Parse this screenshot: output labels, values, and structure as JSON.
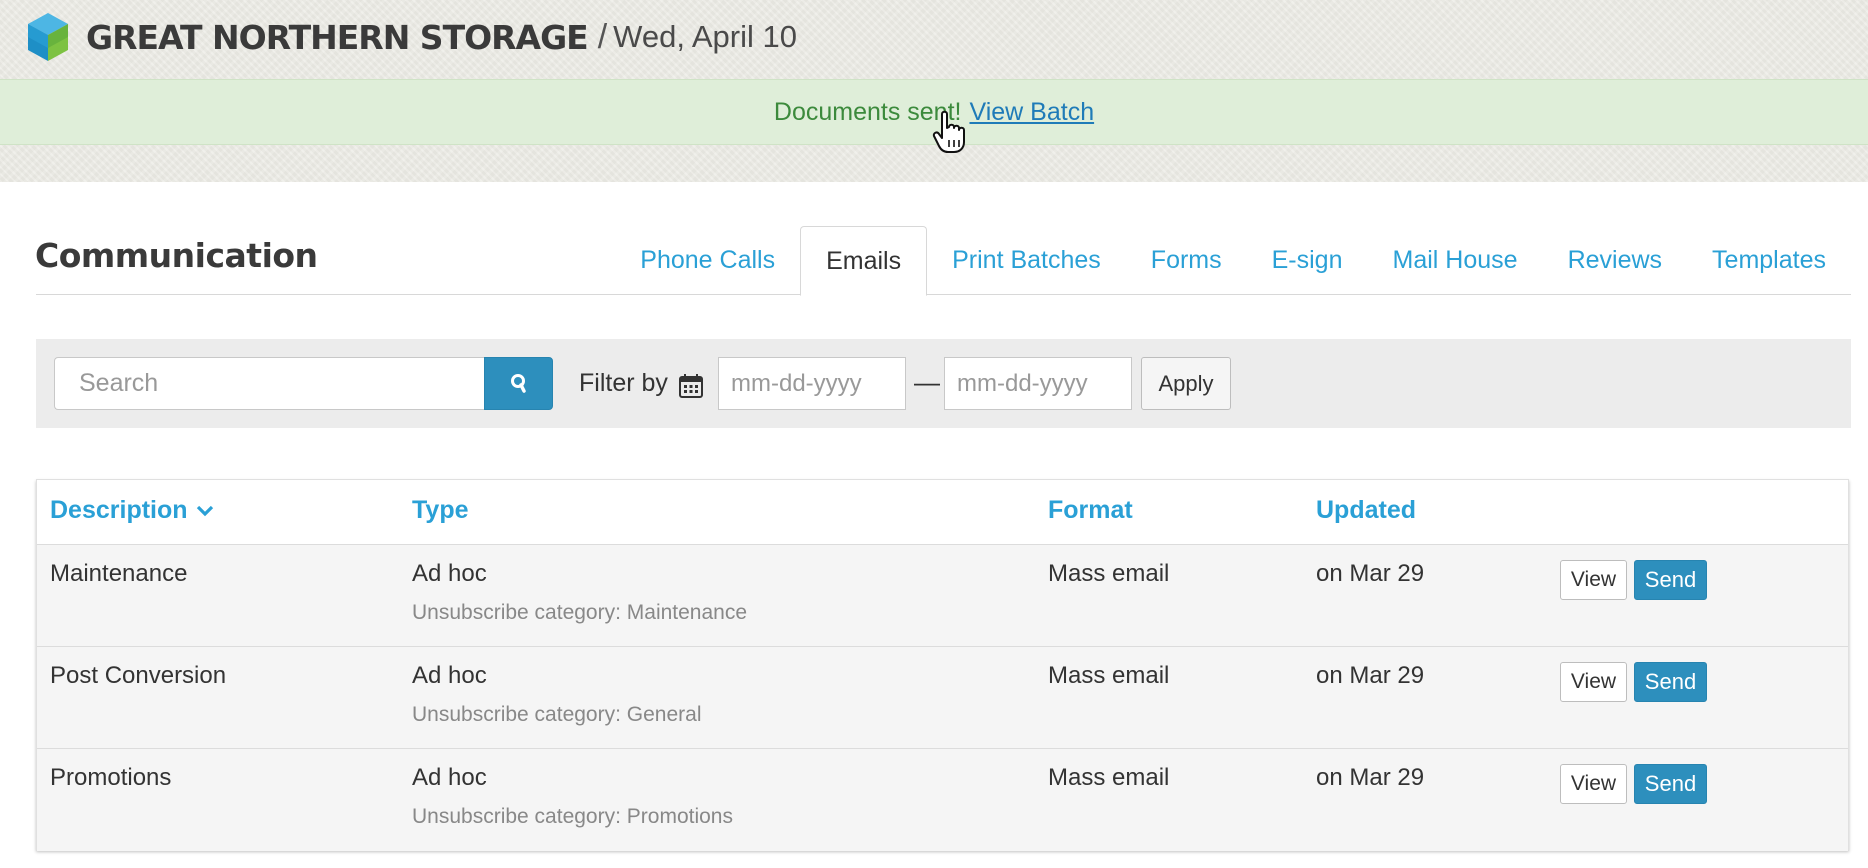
{
  "header": {
    "brand": "GREAT NORTHERN STORAGE",
    "separator": "/",
    "date": "Wed, April 10",
    "logo_icon": "cube-logo-icon"
  },
  "flash": {
    "message": "Documents sent!",
    "link_label": "View Batch",
    "color": "#3c8a3c",
    "background": "#dfeed9"
  },
  "page": {
    "title": "Communication"
  },
  "tabs": [
    {
      "label": "Phone Calls",
      "active": false
    },
    {
      "label": "Emails",
      "active": true
    },
    {
      "label": "Print Batches",
      "active": false
    },
    {
      "label": "Forms",
      "active": false
    },
    {
      "label": "E-sign",
      "active": false
    },
    {
      "label": "Mail House",
      "active": false
    },
    {
      "label": "Reviews",
      "active": false
    },
    {
      "label": "Templates",
      "active": false
    }
  ],
  "filter": {
    "search_placeholder": "Search",
    "search_icon": "search-icon",
    "filter_label": "Filter by",
    "calendar_icon": "calendar-icon",
    "date_from_placeholder": "mm-dd-yyyy",
    "date_to_placeholder": "mm-dd-yyyy",
    "separator": "—",
    "apply_label": "Apply"
  },
  "table": {
    "columns": {
      "description": "Description",
      "type": "Type",
      "format": "Format",
      "updated": "Updated"
    },
    "sorted_by": "Description",
    "rows": [
      {
        "description": "Maintenance",
        "type": "Ad hoc",
        "subtext": "Unsubscribe category: Maintenance",
        "format": "Mass email",
        "updated": "on Mar 29",
        "view_label": "View",
        "send_label": "Send"
      },
      {
        "description": "Post Conversion",
        "type": "Ad hoc",
        "subtext": "Unsubscribe category: General",
        "format": "Mass email",
        "updated": "on Mar 29",
        "view_label": "View",
        "send_label": "Send"
      },
      {
        "description": "Promotions",
        "type": "Ad hoc",
        "subtext": "Unsubscribe category: Promotions",
        "format": "Mass email",
        "updated": "on Mar 29",
        "view_label": "View",
        "send_label": "Send"
      }
    ]
  },
  "colors": {
    "accent": "#2aa0d6",
    "primary_button": "#2d8fbd"
  }
}
